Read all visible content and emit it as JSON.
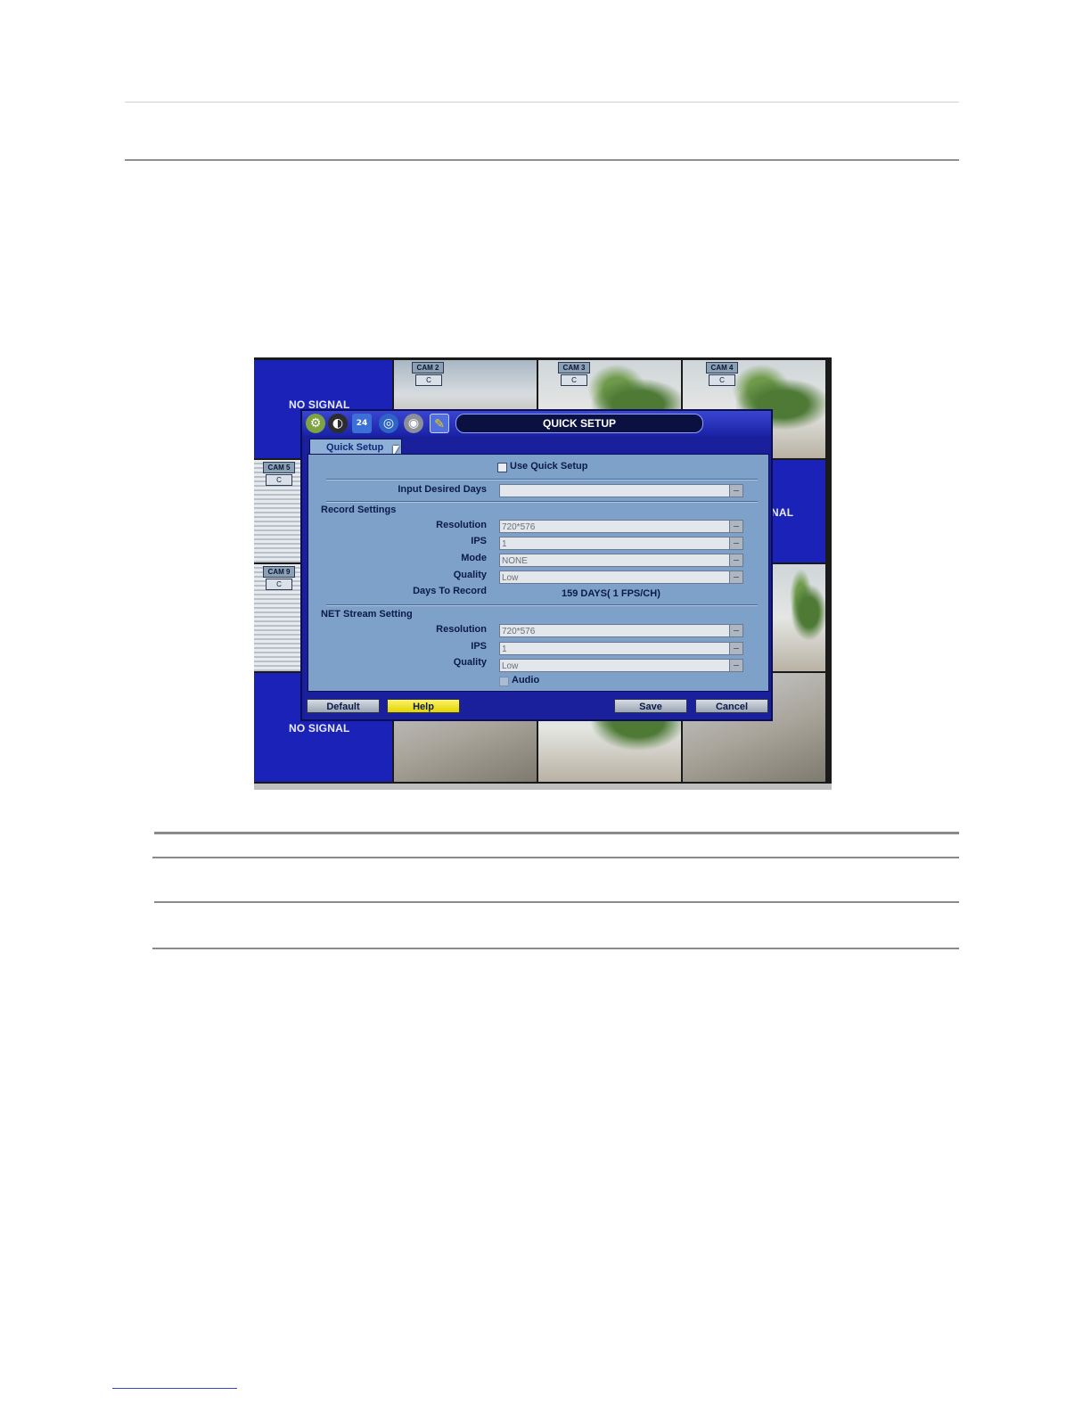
{
  "dvr": {
    "tiles": {
      "no_signal_top": "NO SIGNAL",
      "no_signal_bottom": "NO SIGNAL",
      "cam2": "CAM 2",
      "cam3": "CAM 3",
      "cam4": "CAM 4",
      "cam5": "CAM 5",
      "cam9": "CAM 9",
      "icon_glyph": "C",
      "partial_right": "NAL"
    },
    "dialog": {
      "title": "QUICK SETUP",
      "tab_label": "Quick Setup",
      "use_quick_setup_label": "Use Quick Setup",
      "input_desired_days_label": "Input Desired Days",
      "input_desired_days_value": "",
      "record_settings": {
        "section_label": "Record Settings",
        "resolution_label": "Resolution",
        "resolution_value": "720*576",
        "ips_label": "IPS",
        "ips_value": "1",
        "mode_label": "Mode",
        "mode_value": "NONE",
        "quality_label": "Quality",
        "quality_value": "Low",
        "days_to_record_label": "Days To Record",
        "days_to_record_value": "159 DAYS( 1 FPS/CH)"
      },
      "net_stream": {
        "section_label": "NET Stream Setting",
        "resolution_label": "Resolution",
        "resolution_value": "720*576",
        "ips_label": "IPS",
        "ips_value": "1",
        "quality_label": "Quality",
        "quality_value": "Low",
        "audio_label": "Audio"
      },
      "buttons": {
        "default": "Default",
        "help": "Help",
        "save": "Save",
        "cancel": "Cancel"
      },
      "toolbar_icons": [
        "gear-icon",
        "display-icon",
        "calendar-icon",
        "network-icon",
        "disk-icon",
        "quick-setup-icon"
      ],
      "calendar_icon_text": "24"
    }
  }
}
